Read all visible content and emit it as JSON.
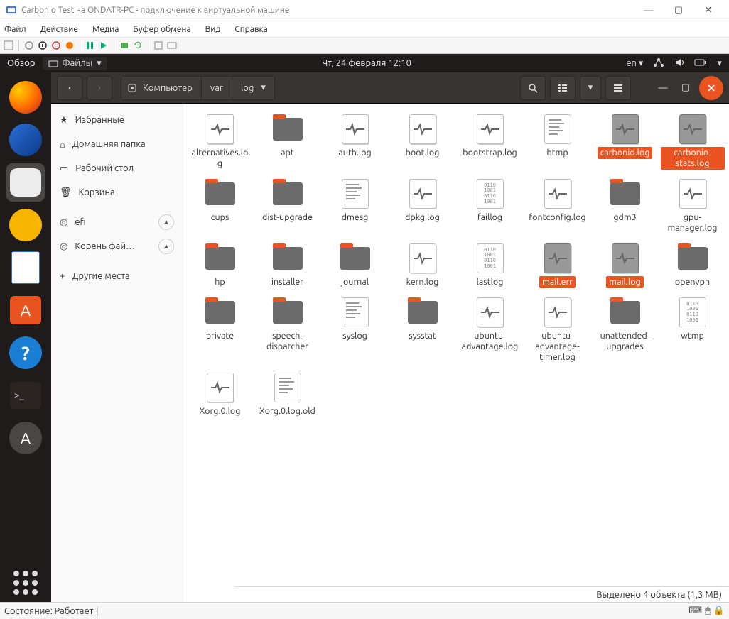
{
  "host": {
    "title": "Carbonio Test на ONDATR-PC - подключение к виртуальной машине",
    "menu": {
      "file": "Файл",
      "action": "Действие",
      "media": "Медиа",
      "clipboard": "Буфер обмена",
      "view": "Вид",
      "help": "Справка"
    },
    "status_label": "Состояние:",
    "status_value": "Работает"
  },
  "panel": {
    "activities": "Обзор",
    "app_label": "Файлы",
    "clock": "Чт, 24 февраля  12:10",
    "lang": "en"
  },
  "path": {
    "root": "Компьютер",
    "p1": "var",
    "p2": "log"
  },
  "sidebar": {
    "favorites": "Избранные",
    "home": "Домашняя папка",
    "desktop": "Рабочий стол",
    "trash": "Корзина",
    "efi": "efi",
    "rootfs": "Корень фай…",
    "other": "Другие места"
  },
  "files": [
    {
      "n": "alternatives.log",
      "t": "log"
    },
    {
      "n": "apt",
      "t": "folder"
    },
    {
      "n": "auth.log",
      "t": "log"
    },
    {
      "n": "boot.log",
      "t": "log"
    },
    {
      "n": "bootstrap.log",
      "t": "log"
    },
    {
      "n": "btmp",
      "t": "txt"
    },
    {
      "n": "carbonio.log",
      "t": "log",
      "sel": true
    },
    {
      "n": "carbonio-stats.log",
      "t": "log",
      "sel": true
    },
    {
      "n": "cups",
      "t": "folder"
    },
    {
      "n": "dist-upgrade",
      "t": "folder"
    },
    {
      "n": "dmesg",
      "t": "txt"
    },
    {
      "n": "dpkg.log",
      "t": "log"
    },
    {
      "n": "faillog",
      "t": "bin"
    },
    {
      "n": "fontconfig.log",
      "t": "log"
    },
    {
      "n": "gdm3",
      "t": "folder"
    },
    {
      "n": "gpu-manager.log",
      "t": "log"
    },
    {
      "n": "hp",
      "t": "folder"
    },
    {
      "n": "installer",
      "t": "folder"
    },
    {
      "n": "journal",
      "t": "folder"
    },
    {
      "n": "kern.log",
      "t": "log"
    },
    {
      "n": "lastlog",
      "t": "bin"
    },
    {
      "n": "mail.err",
      "t": "log",
      "sel": true
    },
    {
      "n": "mail.log",
      "t": "log",
      "sel": true
    },
    {
      "n": "openvpn",
      "t": "folder"
    },
    {
      "n": "private",
      "t": "folder"
    },
    {
      "n": "speech-dispatcher",
      "t": "folder"
    },
    {
      "n": "syslog",
      "t": "txt"
    },
    {
      "n": "sysstat",
      "t": "folder"
    },
    {
      "n": "ubuntu-advantage.log",
      "t": "log"
    },
    {
      "n": "ubuntu-advantage-timer.log",
      "t": "log"
    },
    {
      "n": "unattended-upgrades",
      "t": "folder"
    },
    {
      "n": "wtmp",
      "t": "bin"
    },
    {
      "n": "Xorg.0.log",
      "t": "log"
    },
    {
      "n": "Xorg.0.log.old",
      "t": "txt"
    }
  ],
  "statusbar": "Выделено 4 объекта  (1,3 MB)"
}
